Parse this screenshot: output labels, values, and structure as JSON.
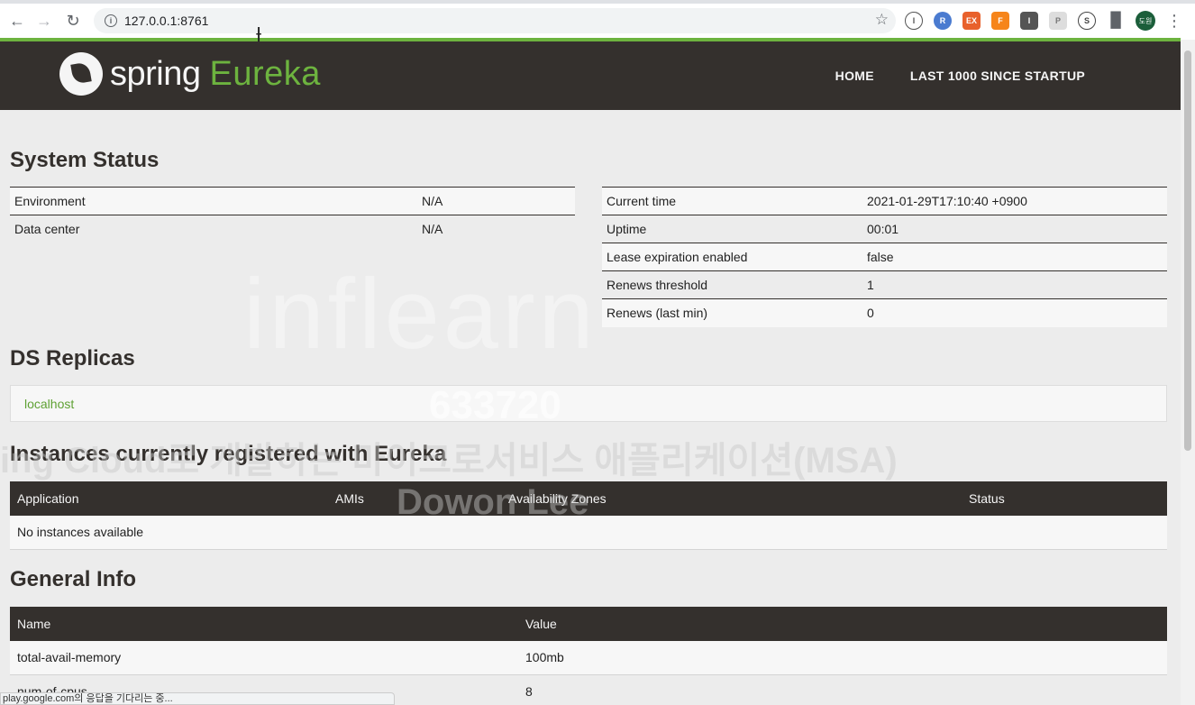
{
  "browser": {
    "url": "127.0.0.1:8761",
    "extensions": [
      "I",
      "R",
      "EX",
      "F",
      "I",
      "P",
      "S",
      "P"
    ],
    "profile_initials": "도원",
    "status_bar": "play.google.com의 응답을 기다리는 중..."
  },
  "header": {
    "logo_word": "spring",
    "logo_accent": "Eureka",
    "nav": [
      "HOME",
      "LAST 1000 SINCE STARTUP"
    ]
  },
  "system_status": {
    "title": "System Status",
    "left_table": [
      {
        "label": "Environment",
        "value": "N/A"
      },
      {
        "label": "Data center",
        "value": "N/A"
      }
    ],
    "right_table": [
      {
        "label": "Current time",
        "value": "2021-01-29T17:10:40 +0900"
      },
      {
        "label": "Uptime",
        "value": "00:01"
      },
      {
        "label": "Lease expiration enabled",
        "value": "false"
      },
      {
        "label": "Renews threshold",
        "value": "1"
      },
      {
        "label": "Renews (last min)",
        "value": "0"
      }
    ]
  },
  "ds_replicas": {
    "title": "DS Replicas",
    "items": [
      "localhost"
    ]
  },
  "instances": {
    "title": "Instances currently registered with Eureka",
    "columns": [
      "Application",
      "AMIs",
      "Availability Zones",
      "Status"
    ],
    "empty_message": "No instances available"
  },
  "general_info": {
    "title": "General Info",
    "columns": [
      "Name",
      "Value"
    ],
    "rows": [
      {
        "name": "total-avail-memory",
        "value": "100mb"
      },
      {
        "name": "num-of-cpus",
        "value": "8"
      }
    ]
  },
  "watermark": {
    "brand": "inflearn",
    "id": "633720",
    "course": "ing Cloud로 개발하는 마이크로서비스 애플리케이션(MSA)",
    "author": "Dowon Lee"
  },
  "colors": {
    "spring_green": "#6db33f",
    "header_dark": "#34302d",
    "link_green": "#5fa134"
  }
}
